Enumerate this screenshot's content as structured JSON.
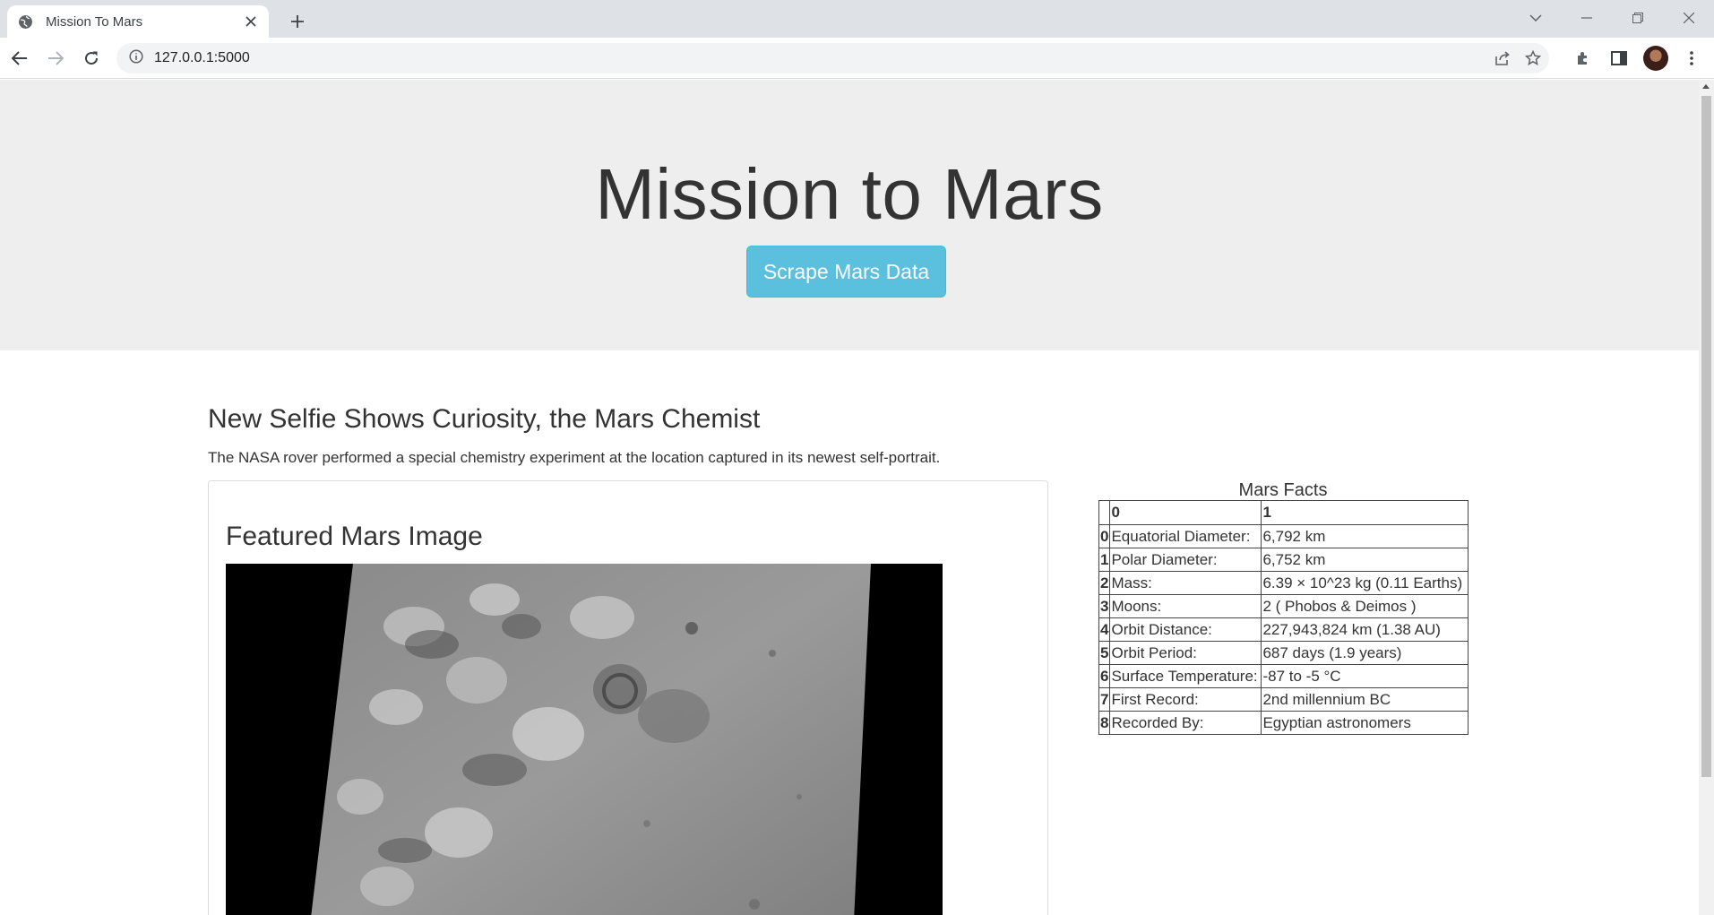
{
  "browser": {
    "tab_title": "Mission To Mars",
    "url": "127.0.0.1:5000"
  },
  "page": {
    "heading": "Mission to Mars",
    "scrape_button": "Scrape Mars Data",
    "news_title": "New Selfie Shows Curiosity, the Mars Chemist",
    "news_paragraph": "The NASA rover performed a special chemistry experiment at the location captured in its newest self-portrait.",
    "featured_heading": "Featured Mars Image",
    "facts": {
      "caption": "Mars Facts",
      "columns": [
        "",
        "0",
        "1"
      ],
      "rows": [
        [
          "0",
          "Equatorial Diameter:",
          "6,792 km"
        ],
        [
          "1",
          "Polar Diameter:",
          "6,752 km"
        ],
        [
          "2",
          "Mass:",
          "6.39 × 10^23 kg (0.11 Earths)"
        ],
        [
          "3",
          "Moons:",
          "2 ( Phobos & Deimos )"
        ],
        [
          "4",
          "Orbit Distance:",
          "227,943,824 km (1.38 AU)"
        ],
        [
          "5",
          "Orbit Period:",
          "687 days (1.9 years)"
        ],
        [
          "6",
          "Surface Temperature:",
          "-87 to -5 °C"
        ],
        [
          "7",
          "First Record:",
          "2nd millennium BC"
        ],
        [
          "8",
          "Recorded By:",
          "Egyptian astronomers"
        ]
      ]
    }
  },
  "colors": {
    "jumbotron_bg": "#eeeeee",
    "button_info": "#5bc0de",
    "text": "#333333"
  }
}
